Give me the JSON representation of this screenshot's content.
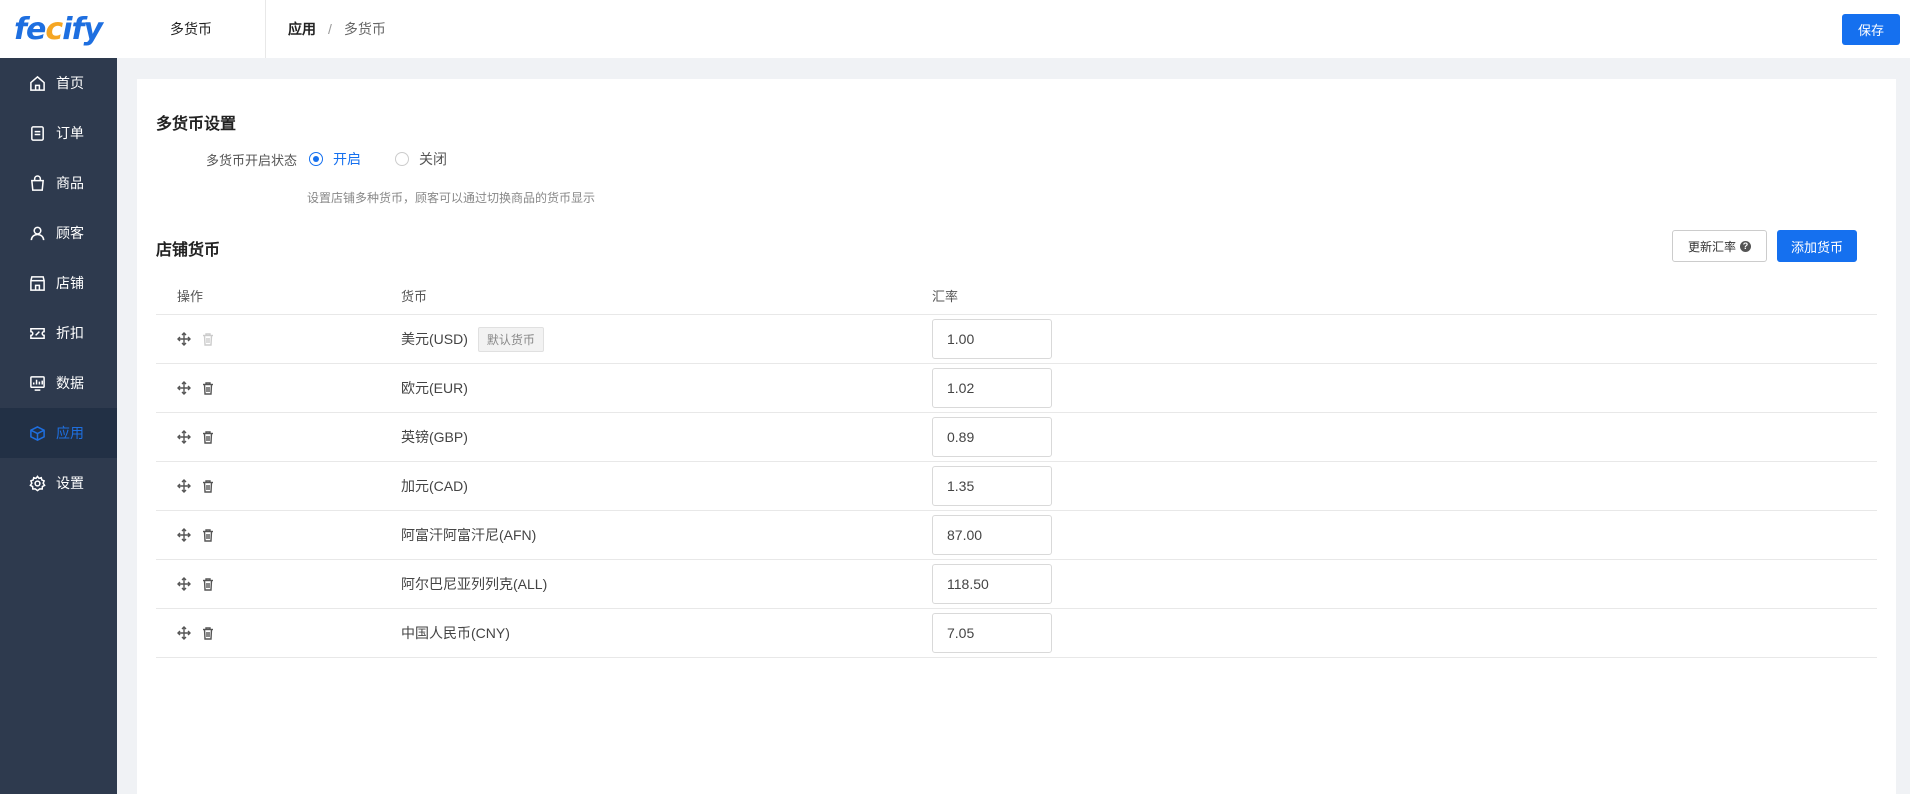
{
  "sidebar": {
    "logo": {
      "main": "fe",
      "swirl": "c",
      "tail": "ify"
    },
    "items": [
      {
        "label": "首页",
        "icon": "home-icon",
        "active": false
      },
      {
        "label": "订单",
        "icon": "order-icon",
        "active": false
      },
      {
        "label": "商品",
        "icon": "bag-icon",
        "active": false
      },
      {
        "label": "顾客",
        "icon": "user-icon",
        "active": false
      },
      {
        "label": "店铺",
        "icon": "store-icon",
        "active": false
      },
      {
        "label": "折扣",
        "icon": "ticket-icon",
        "active": false
      },
      {
        "label": "数据",
        "icon": "chart-icon",
        "active": false
      },
      {
        "label": "应用",
        "icon": "cube-icon",
        "active": true
      },
      {
        "label": "设置",
        "icon": "gear-icon",
        "active": false
      }
    ],
    "active_color": "#1e6fe0",
    "bg_color": "#2e3a4e"
  },
  "header": {
    "section_title": "多货币",
    "breadcrumb_root": "应用",
    "breadcrumb_sep": "/",
    "breadcrumb_current": "多货币",
    "save_label": "保存"
  },
  "settings": {
    "title": "多货币设置",
    "status_label": "多货币开启状态",
    "option_on": "开启",
    "option_off": "关闭",
    "selected": "开启",
    "hint": "设置店铺多种货币，顾客可以通过切换商品的货币显示"
  },
  "store_currency": {
    "title": "店铺货币",
    "refresh_label": "更新汇率",
    "refresh_help": "?",
    "add_label": "添加货币",
    "columns": {
      "op": "操作",
      "currency": "货币",
      "rate": "汇率"
    },
    "rows": [
      {
        "currency": "美元(USD)",
        "badge": "默认货币",
        "rate": "1.00",
        "deletable": false
      },
      {
        "currency": "欧元(EUR)",
        "badge": "",
        "rate": "1.02",
        "deletable": true
      },
      {
        "currency": "英镑(GBP)",
        "badge": "",
        "rate": "0.89",
        "deletable": true
      },
      {
        "currency": "加元(CAD)",
        "badge": "",
        "rate": "1.35",
        "deletable": true
      },
      {
        "currency": "阿富汗阿富汗尼(AFN)",
        "badge": "",
        "rate": "87.00",
        "deletable": true
      },
      {
        "currency": "阿尔巴尼亚列列克(ALL)",
        "badge": "",
        "rate": "118.50",
        "deletable": true
      },
      {
        "currency": "中国人民币(CNY)",
        "badge": "",
        "rate": "7.05",
        "deletable": true
      }
    ]
  },
  "colors": {
    "primary": "#1570ef"
  }
}
